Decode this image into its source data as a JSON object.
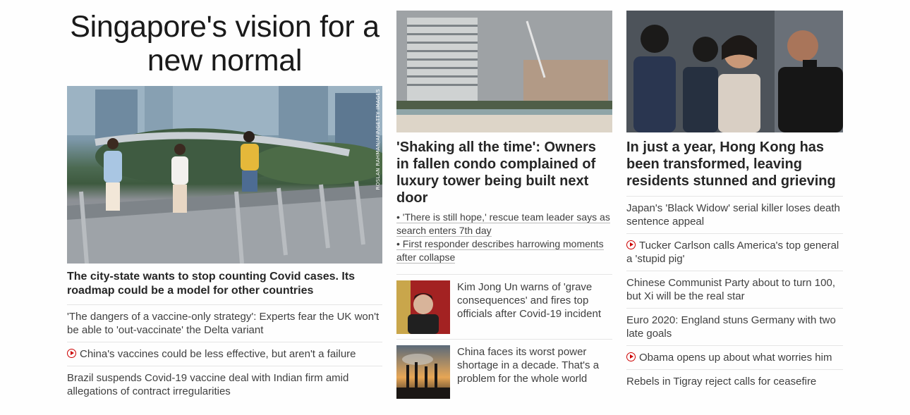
{
  "column1": {
    "headline": "Singapore's vision for a new normal",
    "photo_credit": "ROSLAN RAHMAN/AFP/GETTY IMAGES",
    "main_story": "The city-state wants to stop counting Covid cases. Its roadmap could be a model for other countries",
    "links": [
      {
        "text": "'The dangers of a vaccine-only strategy': Experts fear the UK won't be able to 'out-vaccinate' the Delta variant",
        "video": false
      },
      {
        "text": "China's vaccines could be less effective, but aren't a failure",
        "video": true
      },
      {
        "text": "Brazil suspends Covid-19 vaccine deal with Indian firm amid allegations of contract irregularities",
        "video": false
      }
    ]
  },
  "column2": {
    "main_story": "'Shaking all the time': Owners in fallen condo complained of luxury tower being built next door",
    "bullets": [
      "• 'There is still hope,' rescue team leader says as search enters 7th day",
      "• First responder describes harrowing moments after collapse"
    ],
    "cards": [
      {
        "text": "Kim Jong Un warns of 'grave consequences' and fires top officials after Covid-19 incident"
      },
      {
        "text": "China faces its worst power shortage in a decade. That's a problem for the whole world"
      }
    ]
  },
  "column3": {
    "main_story": "In just a year, Hong Kong has been transformed, leaving residents stunned and grieving",
    "links": [
      {
        "text": "Japan's 'Black Widow' serial killer loses death sentence appeal",
        "video": false
      },
      {
        "text": "Tucker Carlson calls America's top general a 'stupid pig'",
        "video": true
      },
      {
        "text": "Chinese Communist Party about to turn 100, but Xi will be the real star",
        "video": false
      },
      {
        "text": "Euro 2020: England stuns Germany with two late goals",
        "video": false
      },
      {
        "text": "Obama opens up about what worries him",
        "video": true
      },
      {
        "text": "Rebels in Tigray reject calls for ceasefire",
        "video": false
      }
    ]
  },
  "colors": {
    "video_icon": "#cc0000",
    "text": "#262626",
    "divider": "#e5e5e5"
  }
}
